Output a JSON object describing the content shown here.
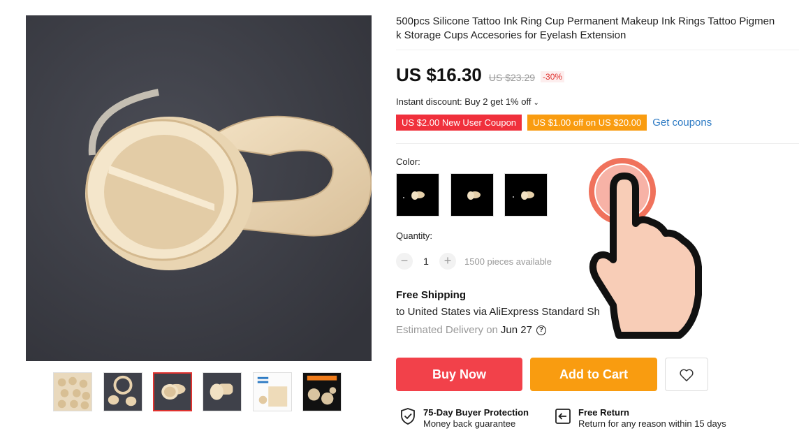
{
  "product": {
    "title": "500pcs Silicone Tattoo Ink Ring Cup Permanent Makeup Ink Rings Tattoo Pigmen k Storage Cups Accesories for Eyelash Extension",
    "title_line1": "500pcs Silicone Tattoo Ink Ring Cup Permanent Makeup Ink Rings Tattoo Pigmen",
    "title_line2": "k Storage Cups Accesories for Eyelash Extension"
  },
  "price": {
    "current": "US $16.30",
    "original": "US $23.29",
    "discount": "-30%"
  },
  "instant_discount": "Instant discount: Buy 2 get 1% off",
  "coupons": {
    "new_user": "US $2.00 New User Coupon",
    "off": "US $1.00 off on US $20.00",
    "get": "Get coupons"
  },
  "color": {
    "label": "Color:",
    "options_count": 3
  },
  "quantity": {
    "label": "Quantity:",
    "minus": "−",
    "value": "1",
    "plus": "+",
    "available": "1500 pieces available"
  },
  "shipping": {
    "title": "Free Shipping",
    "line": "to United States via AliExpress Standard Sh",
    "eta_label": "Estimated Delivery on",
    "eta_date": "Jun 27",
    "help": "?"
  },
  "actions": {
    "buy_now": "Buy Now",
    "add_to_cart": "Add to Cart"
  },
  "protection": {
    "buyer_title": "75-Day Buyer Protection",
    "buyer_sub": "Money back guarantee",
    "return_title": "Free Return",
    "return_sub": "Return for any reason within 15 days"
  },
  "thumbnails": {
    "count": 6,
    "active_index": 2
  },
  "colors": {
    "accent_red": "#f2414a",
    "accent_orange": "#f99c10",
    "link_blue": "#2e7bc4"
  }
}
